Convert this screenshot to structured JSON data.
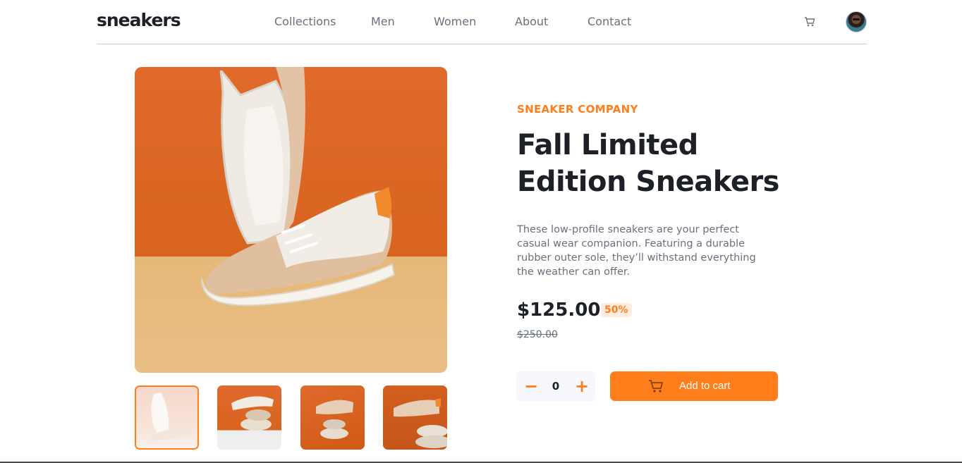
{
  "header": {
    "logo": "sneakers",
    "nav": [
      {
        "label": "Collections"
      },
      {
        "label": "Men"
      },
      {
        "label": "Women"
      },
      {
        "label": "About"
      },
      {
        "label": "Contact"
      }
    ],
    "cart_icon": "cart-icon",
    "avatar_icon": "avatar"
  },
  "gallery": {
    "thumbnails_count": 4,
    "active_thumbnail": 1
  },
  "product": {
    "company": "SNEAKER COMPANY",
    "title_line1": "Fall Limited",
    "title_line2": "Edition Sneakers",
    "description": "These low-profile sneakers are your perfect casual wear companion. Featuring a durable rubber outer sole, they’ll withstand everything the weather can offer.",
    "price": "$125.00",
    "discount": "50%",
    "old_price": "$250.00"
  },
  "cart_controls": {
    "minus": "−",
    "quantity": "0",
    "plus": "+",
    "add_label": "Add to cart"
  },
  "colors": {
    "accent": "#ff7e1b",
    "accent_pale": "#ffede0",
    "text_dark": "#1d2026",
    "text_gray": "#69707d"
  }
}
